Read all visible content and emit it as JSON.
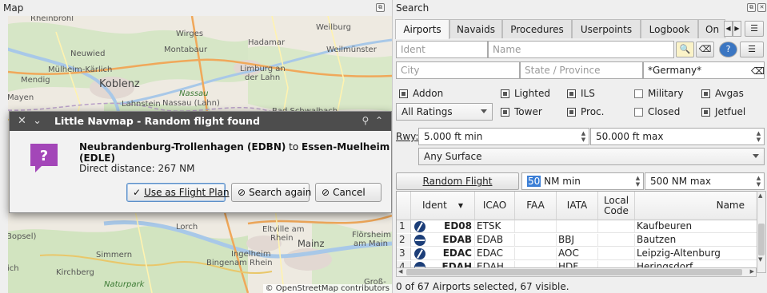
{
  "map_panel": {
    "title": "Map",
    "attribution": "© OpenStreetMap contributors",
    "labels": [
      {
        "text": "Rheinbrohl",
        "kind": "normal"
      },
      {
        "text": "Wirges",
        "kind": "normal"
      },
      {
        "text": "Hadamar",
        "kind": "normal"
      },
      {
        "text": "Weilburg",
        "kind": "normal"
      },
      {
        "text": "Montabaur",
        "kind": "normal"
      },
      {
        "text": "Weilmünster",
        "kind": "normal"
      },
      {
        "text": "Neuwied",
        "kind": "normal"
      },
      {
        "text": "Mülheim-Kärlich",
        "kind": "normal"
      },
      {
        "text": "Limburg an",
        "kind": "normal"
      },
      {
        "text": "der Lahn",
        "kind": "normal"
      },
      {
        "text": "Mendig",
        "kind": "normal"
      },
      {
        "text": "Koblenz",
        "kind": "big"
      },
      {
        "text": "Nassau",
        "kind": "green"
      },
      {
        "text": "Mayen",
        "kind": "normal"
      },
      {
        "text": "Lahnstein",
        "kind": "normal"
      },
      {
        "text": "Nassau (Lahn)",
        "kind": "normal"
      },
      {
        "text": "Bad Schwalbach",
        "kind": "normal"
      },
      {
        "text": "Lorch",
        "kind": "normal"
      },
      {
        "text": "Eltville am",
        "kind": "normal"
      },
      {
        "text": "Rhein",
        "kind": "normal"
      },
      {
        "text": "Flörsheim",
        "kind": "normal"
      },
      {
        "text": "am Main",
        "kind": "normal"
      },
      {
        "text": "Bopsel)",
        "kind": "normal"
      },
      {
        "text": "Mainz",
        "kind": "mid"
      },
      {
        "text": "Simmern",
        "kind": "normal"
      },
      {
        "text": "Ingelheim",
        "kind": "normal"
      },
      {
        "text": "Bingen",
        "kind": "normal"
      },
      {
        "text": "am Rhein",
        "kind": "normal"
      },
      {
        "text": "ich",
        "kind": "normal"
      },
      {
        "text": "Kirchberg",
        "kind": "normal"
      },
      {
        "text": "Naturpark",
        "kind": "green"
      },
      {
        "text": "Groß-",
        "kind": "normal"
      }
    ]
  },
  "dialog": {
    "title": "Little Navmap - Random flight found",
    "from": "Neubrandenburg-Trollenhagen (EDBN)",
    "connector": " to ",
    "to": "Essen-Muelheim (EDLE)",
    "distance": "Direct distance: 267 NM",
    "buttons": {
      "use": "Use as Flight Plan",
      "search_again": "Search again",
      "cancel": "Cancel"
    }
  },
  "search_panel": {
    "title": "Search",
    "tabs": [
      "Airports",
      "Navaids",
      "Procedures",
      "Userpoints",
      "Logbook",
      "On"
    ],
    "active_tab": "Airports",
    "fields": {
      "ident_placeholder": "Ident",
      "name_placeholder": "Name",
      "city_placeholder": "City",
      "state_placeholder": "State / Province",
      "country_value": "*Germany*"
    },
    "checkboxes": {
      "addon": "Addon",
      "lighted": "Lighted",
      "ils": "ILS",
      "military": "Military",
      "avgas": "Avgas",
      "tower": "Tower",
      "proc": "Proc.",
      "closed": "Closed",
      "jetfuel": "Jetfuel"
    },
    "ratings_combo": "All Ratings",
    "rwy_label": "Rwy:",
    "rwy_min": "5.000 ft min",
    "rwy_max": "50.000 ft max",
    "surface_combo": "Any Surface",
    "random_flight_button": "Random Flight",
    "nm_min_value": "50",
    "nm_min_suffix": " NM min",
    "nm_max": "500 NM max",
    "table": {
      "headers": [
        "Ident",
        "ICAO",
        "FAA",
        "IATA",
        "Local Code",
        "Name"
      ],
      "rows": [
        {
          "num": "1",
          "ident": "ED08",
          "icao": "ETSK",
          "faa": "",
          "iata": "",
          "local": "",
          "name": "Kaufbeuren",
          "icon": "airport-icon"
        },
        {
          "num": "2",
          "ident": "EDAB",
          "icao": "EDAB",
          "faa": "",
          "iata": "BBJ",
          "local": "",
          "name": "Bautzen",
          "icon": "airport-icon"
        },
        {
          "num": "3",
          "ident": "EDAC",
          "icao": "EDAC",
          "faa": "",
          "iata": "AOC",
          "local": "",
          "name": "Leipzig-Altenburg",
          "icon": "airport-icon"
        },
        {
          "num": "4",
          "ident": "EDAH",
          "icao": "EDAH",
          "faa": "",
          "iata": "HDF",
          "local": "",
          "name": "Heringsdorf",
          "icon": "airport-icon"
        }
      ]
    },
    "status": "0 of 67 Airports selected, 67 visible."
  }
}
